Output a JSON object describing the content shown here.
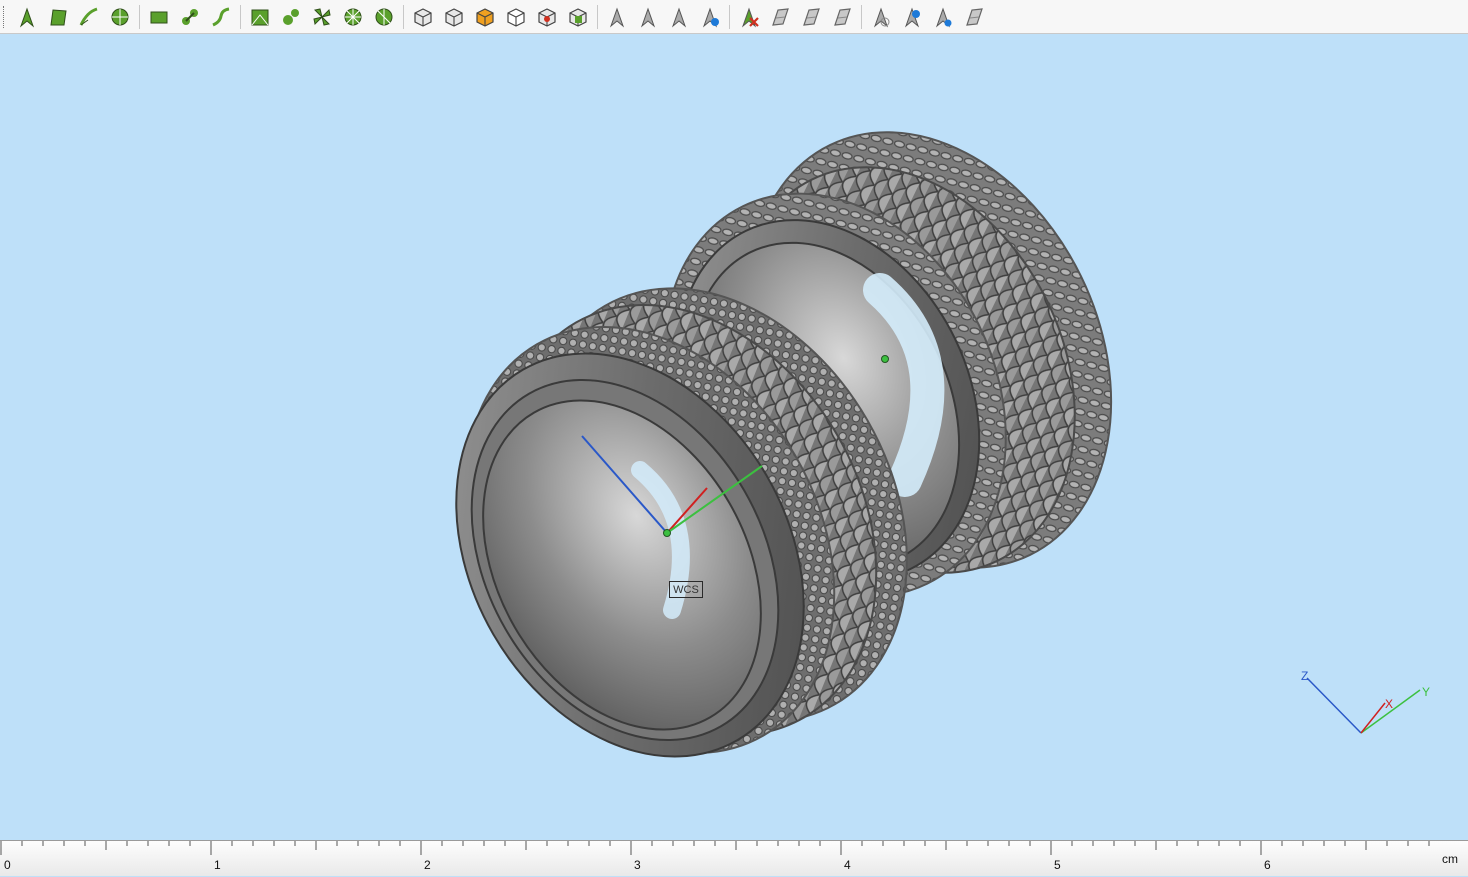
{
  "toolbar": {
    "groups": [
      [
        "select-arrow-icon",
        "select-face-icon",
        "select-curve-icon",
        "select-sphere-icon"
      ],
      [
        "rectangle-select-icon",
        "link-select-icon",
        "path-select-icon"
      ],
      [
        "mesh-select-icon",
        "node-select-icon",
        "clover-select-icon",
        "wheel-select-icon",
        "wheel-partial-select-icon"
      ],
      [
        "solid-cube-icon",
        "cube-edges-icon",
        "colored-cube-icon",
        "wire-cube-icon",
        "cube-record-icon",
        "cube-grid-icon"
      ],
      [
        "arrow-pick-icon",
        "arrow-lines-icon",
        "arrow-multi-icon",
        "arrow-globe-icon"
      ],
      [
        "arrow-delete-icon",
        "surface-shade-icon",
        "surface-copy-icon",
        "surface-flat-icon"
      ],
      [
        "arrow-gauge-icon",
        "arrow-info-icon",
        "arrow-target-icon",
        "surface-check-icon"
      ]
    ]
  },
  "viewport": {
    "wcs_label": "WCS",
    "triad": {
      "x": "X",
      "y": "Y",
      "z": "Z"
    }
  },
  "ruler": {
    "labels": [
      "0",
      "1",
      "2",
      "3",
      "4",
      "5",
      "6"
    ],
    "unit": "cm"
  },
  "colors": {
    "background": "#bee0f9",
    "model": "#808080",
    "x_axis": "#d02020",
    "y_axis": "#3cc040",
    "z_axis": "#2a58c8"
  }
}
